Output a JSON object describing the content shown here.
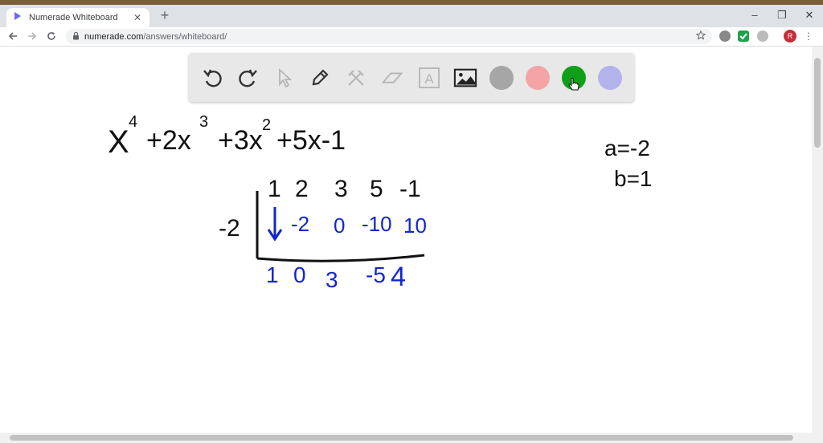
{
  "browser": {
    "tab_title": "Numerade Whiteboard",
    "tab_close": "✕",
    "new_tab": "+",
    "url_host": "numerade.com",
    "url_path": "/answers/whiteboard/",
    "window_controls": {
      "minimize": "–",
      "restore": "❐",
      "close": "✕"
    },
    "avatar_letter": "R"
  },
  "toolbar": {
    "tools": [
      "undo-icon",
      "redo-icon",
      "pointer-icon",
      "pen-icon",
      "tools-icon",
      "eraser-icon",
      "text-icon",
      "image-icon"
    ],
    "text_tool_letter": "A",
    "colors": [
      "#a6a6a6",
      "#f4a4a4",
      "#0f9f18",
      "#b3b3ec"
    ],
    "selected_color": "#0f9f18"
  },
  "whiteboard": {
    "polynomial": {
      "base1": "X",
      "exp1": "4",
      "t2": "+2x",
      "exp2": "3",
      "t3": "+3x",
      "exp3": "2",
      "rest": "+5x-1"
    },
    "divisor": "-2",
    "coefficients": [
      "1",
      "2",
      "3",
      "5",
      "-1"
    ],
    "products": [
      "-2",
      "0",
      "-10",
      "10"
    ],
    "results": [
      "1",
      "0",
      "3",
      "-5",
      "4"
    ],
    "notes": {
      "a": "a=-2",
      "b": "b=1"
    },
    "black_ink": "#111111",
    "blue_ink": "#1326c9"
  }
}
